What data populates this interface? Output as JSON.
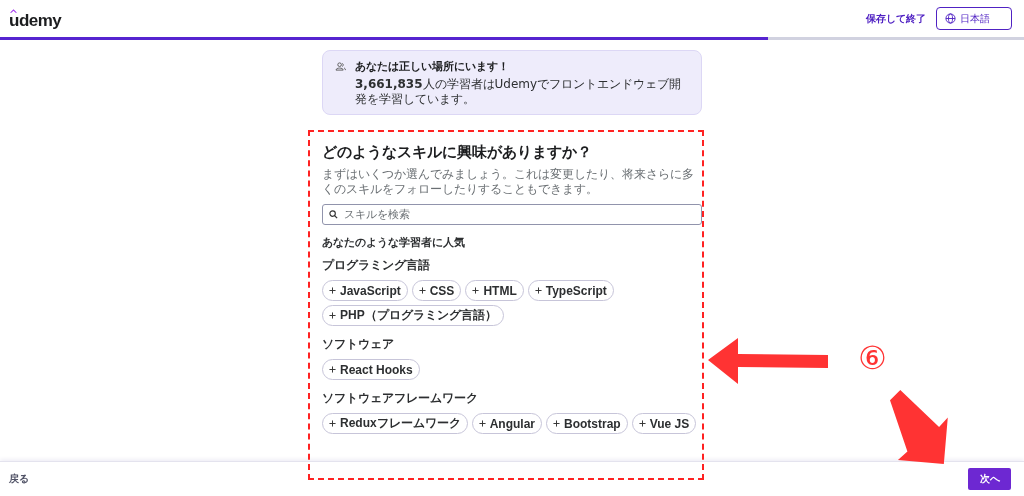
{
  "header": {
    "logo": "udemy",
    "save_exit": "保存して終了",
    "language": "日本語"
  },
  "progress": {
    "level": 0.75
  },
  "banner": {
    "title": "あなたは正しい場所にいます！",
    "text": "**3,661,835**人の学習者はUdemyでフロントエンドウェブ開発を学習しています。"
  },
  "question": {
    "title": "どのようなスキルに興味がありますか？",
    "description": "まずはいくつか選んでみましょう。これは変更したり、将来さらに多くのスキルをフォローしたりすることもできます。",
    "search": {
      "placeholder": "スキルを検索"
    },
    "popular_heading": "あなたのような学習者に人気",
    "sections": [
      {
        "heading": "プログラミング言語",
        "skills": [
          {
            "label": "JavaScript",
            "selected": false
          },
          {
            "label": "CSS",
            "selected": false
          },
          {
            "label": "HTML",
            "selected": false
          },
          {
            "label": "TypeScript",
            "selected": false
          },
          {
            "label": "PHP（プログラミング言語）",
            "selected": false
          }
        ]
      },
      {
        "heading": "ソフトウェア",
        "skills": [
          {
            "label": "React Hooks",
            "selected": false
          }
        ]
      },
      {
        "heading": "ソフトウェアフレームワーク",
        "skills": [
          {
            "label": "Reduxフレームワーク",
            "selected": false
          },
          {
            "label": "Angular",
            "selected": false
          },
          {
            "label": "Bootstrap",
            "selected": false
          },
          {
            "label": "Vue JS",
            "selected": false
          }
        ]
      }
    ]
  },
  "footer": {
    "back": "戻る",
    "next": "次へ"
  },
  "annotations": {
    "step_number": "⑥"
  }
}
